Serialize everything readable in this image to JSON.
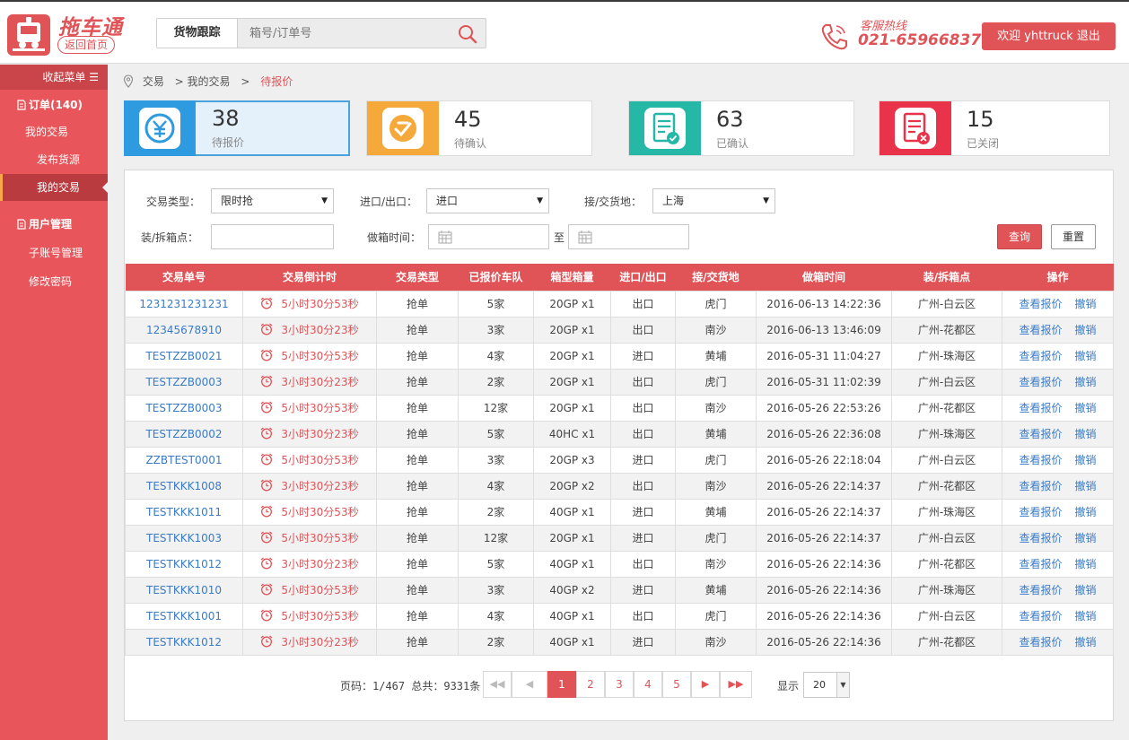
{
  "brand": {
    "name": "拖车通",
    "home_link": "返回首页",
    "accent": "#e05357"
  },
  "search": {
    "tab_label": "货物跟踪",
    "placeholder": "箱号/订单号"
  },
  "hotline": {
    "label": "客服热线",
    "number": "021-65966837"
  },
  "welcome": "欢迎 yhttruck 退出",
  "sidebar": {
    "collapse": "收起菜单 ☰",
    "groups": [
      {
        "title": "订单(140)",
        "items": [
          "我的交易",
          "发布货源",
          "我的交易"
        ]
      },
      {
        "title": "用户管理",
        "items": [
          "子账号管理",
          "修改密码"
        ]
      }
    ]
  },
  "breadcrumb": [
    "交易",
    ">  我的交易",
    ">",
    "待报价"
  ],
  "stats": [
    {
      "count": "38",
      "label": "待报价",
      "color": "#2e9be0",
      "icon": "yen-refresh-icon"
    },
    {
      "count": "45",
      "label": "待确认",
      "color": "#f6a93b",
      "icon": "handshake-icon"
    },
    {
      "count": "63",
      "label": "已确认",
      "color": "#25b8a6",
      "icon": "doc-check-icon"
    },
    {
      "count": "15",
      "label": "已关闭",
      "color": "#e8334a",
      "icon": "doc-close-icon"
    }
  ],
  "filters": {
    "trade_type": {
      "label": "交易类型：",
      "value": "限时抢"
    },
    "io": {
      "label": "进口/出口：",
      "value": "进口"
    },
    "place": {
      "label": "接/交货地：",
      "value": "上海"
    },
    "pack_point": {
      "label": "装/拆箱点："
    },
    "time": {
      "label": "做箱时间：",
      "to": "至"
    },
    "query": "查询",
    "reset": "重置"
  },
  "table": {
    "headers": [
      "交易单号",
      "交易倒计时",
      "交易类型",
      "已报价车队",
      "箱型箱量",
      "进口/出口",
      "接/交货地",
      "做箱时间",
      "装/拆箱点",
      "操作"
    ],
    "actions": [
      "查看报价",
      "撤销"
    ],
    "rows": [
      [
        "1231231231231",
        "5小时30分53秒",
        "抢单",
        "5家",
        "20GP x1",
        "出口",
        "虎门",
        "2016-06-13 14:22:36",
        "广州-白云区"
      ],
      [
        "12345678910",
        "3小时30分23秒",
        "抢单",
        "3家",
        "20GP x1",
        "出口",
        "南沙",
        "2016-06-13 13:46:09",
        "广州-花都区"
      ],
      [
        "TESTZZB0021",
        "5小时30分53秒",
        "抢单",
        "4家",
        "20GP x1",
        "进口",
        "黄埔",
        "2016-05-31 11:04:27",
        "广州-珠海区"
      ],
      [
        "TESTZZB0003",
        "3小时30分23秒",
        "抢单",
        "2家",
        "20GP x1",
        "出口",
        "虎门",
        "2016-05-31 11:02:39",
        "广州-白云区"
      ],
      [
        "TESTZZB0003",
        "5小时30分53秒",
        "抢单",
        "12家",
        "20GP x1",
        "出口",
        "南沙",
        "2016-05-26 22:53:26",
        "广州-花都区"
      ],
      [
        "TESTZZB0002",
        "3小时30分23秒",
        "抢单",
        "5家",
        "40HC x1",
        "出口",
        "黄埔",
        "2016-05-26 22:36:08",
        "广州-珠海区"
      ],
      [
        "ZZBTEST0001",
        "5小时30分53秒",
        "抢单",
        "3家",
        "20GP x3",
        "进口",
        "虎门",
        "2016-05-26 22:18:04",
        "广州-白云区"
      ],
      [
        "TESTKKK1008",
        "3小时30分23秒",
        "抢单",
        "4家",
        "20GP x2",
        "出口",
        "南沙",
        "2016-05-26 22:14:37",
        "广州-花都区"
      ],
      [
        "TESTKKK1011",
        "5小时30分53秒",
        "抢单",
        "2家",
        "40GP x1",
        "进口",
        "黄埔",
        "2016-05-26 22:14:37",
        "广州-珠海区"
      ],
      [
        "TESTKKK1003",
        "5小时30分53秒",
        "抢单",
        "12家",
        "20GP x1",
        "进口",
        "虎门",
        "2016-05-26 22:14:37",
        "广州-白云区"
      ],
      [
        "TESTKKK1012",
        "3小时30分23秒",
        "抢单",
        "5家",
        "40GP x1",
        "出口",
        "南沙",
        "2016-05-26 22:14:36",
        "广州-花都区"
      ],
      [
        "TESTKKK1010",
        "5小时30分53秒",
        "抢单",
        "3家",
        "40GP x2",
        "进口",
        "黄埔",
        "2016-05-26 22:14:36",
        "广州-珠海区"
      ],
      [
        "TESTKKK1001",
        "5小时30分53秒",
        "抢单",
        "4家",
        "40GP x1",
        "出口",
        "虎门",
        "2016-05-26 22:14:36",
        "广州-白云区"
      ],
      [
        "TESTKKK1012",
        "3小时30分23秒",
        "抢单",
        "2家",
        "40GP x1",
        "进口",
        "南沙",
        "2016-05-26 22:14:36",
        "广州-花都区"
      ]
    ]
  },
  "pagination": {
    "summary": "页码：1/467 总共：9331条",
    "pages": [
      "1",
      "2",
      "3",
      "4",
      "5"
    ],
    "current": "1",
    "show_label": "显示",
    "page_size": "20"
  }
}
